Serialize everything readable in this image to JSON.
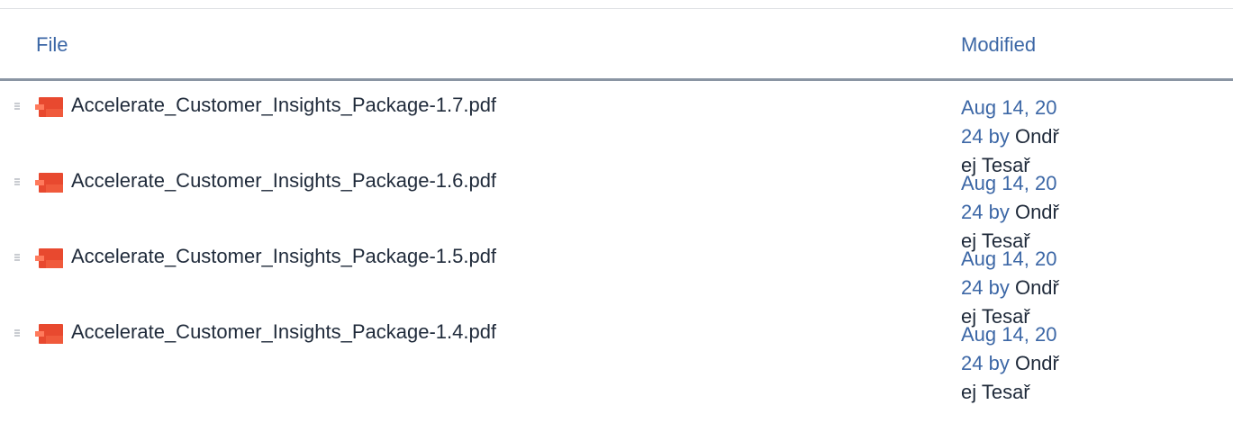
{
  "table": {
    "columns": {
      "file": "File",
      "modified": "Modified"
    },
    "rows": [
      {
        "icon": "pdf-icon",
        "file_name": "Accelerate_Customer_Insights_Package-1.7.pdf",
        "date": "Aug 14, 2024",
        "by": " by ",
        "user": "Ondřej Tesař"
      },
      {
        "icon": "pdf-icon",
        "file_name": "Accelerate_Customer_Insights_Package-1.6.pdf",
        "date": "Aug 14, 2024",
        "by": " by ",
        "user": "Ondřej Tesař"
      },
      {
        "icon": "pdf-icon",
        "file_name": "Accelerate_Customer_Insights_Package-1.5.pdf",
        "date": "Aug 14, 2024",
        "by": " by ",
        "user": "Ondřej Tesař"
      },
      {
        "icon": "pdf-icon",
        "file_name": "Accelerate_Customer_Insights_Package-1.4.pdf",
        "date": "Aug 14, 2024",
        "by": " by ",
        "user": "Ondřej Tesař"
      }
    ]
  },
  "colors": {
    "link": "#3c67a6",
    "text": "#1f2a3a",
    "pdf_red": "#e8492f",
    "header_rule": "#8a95a3"
  }
}
